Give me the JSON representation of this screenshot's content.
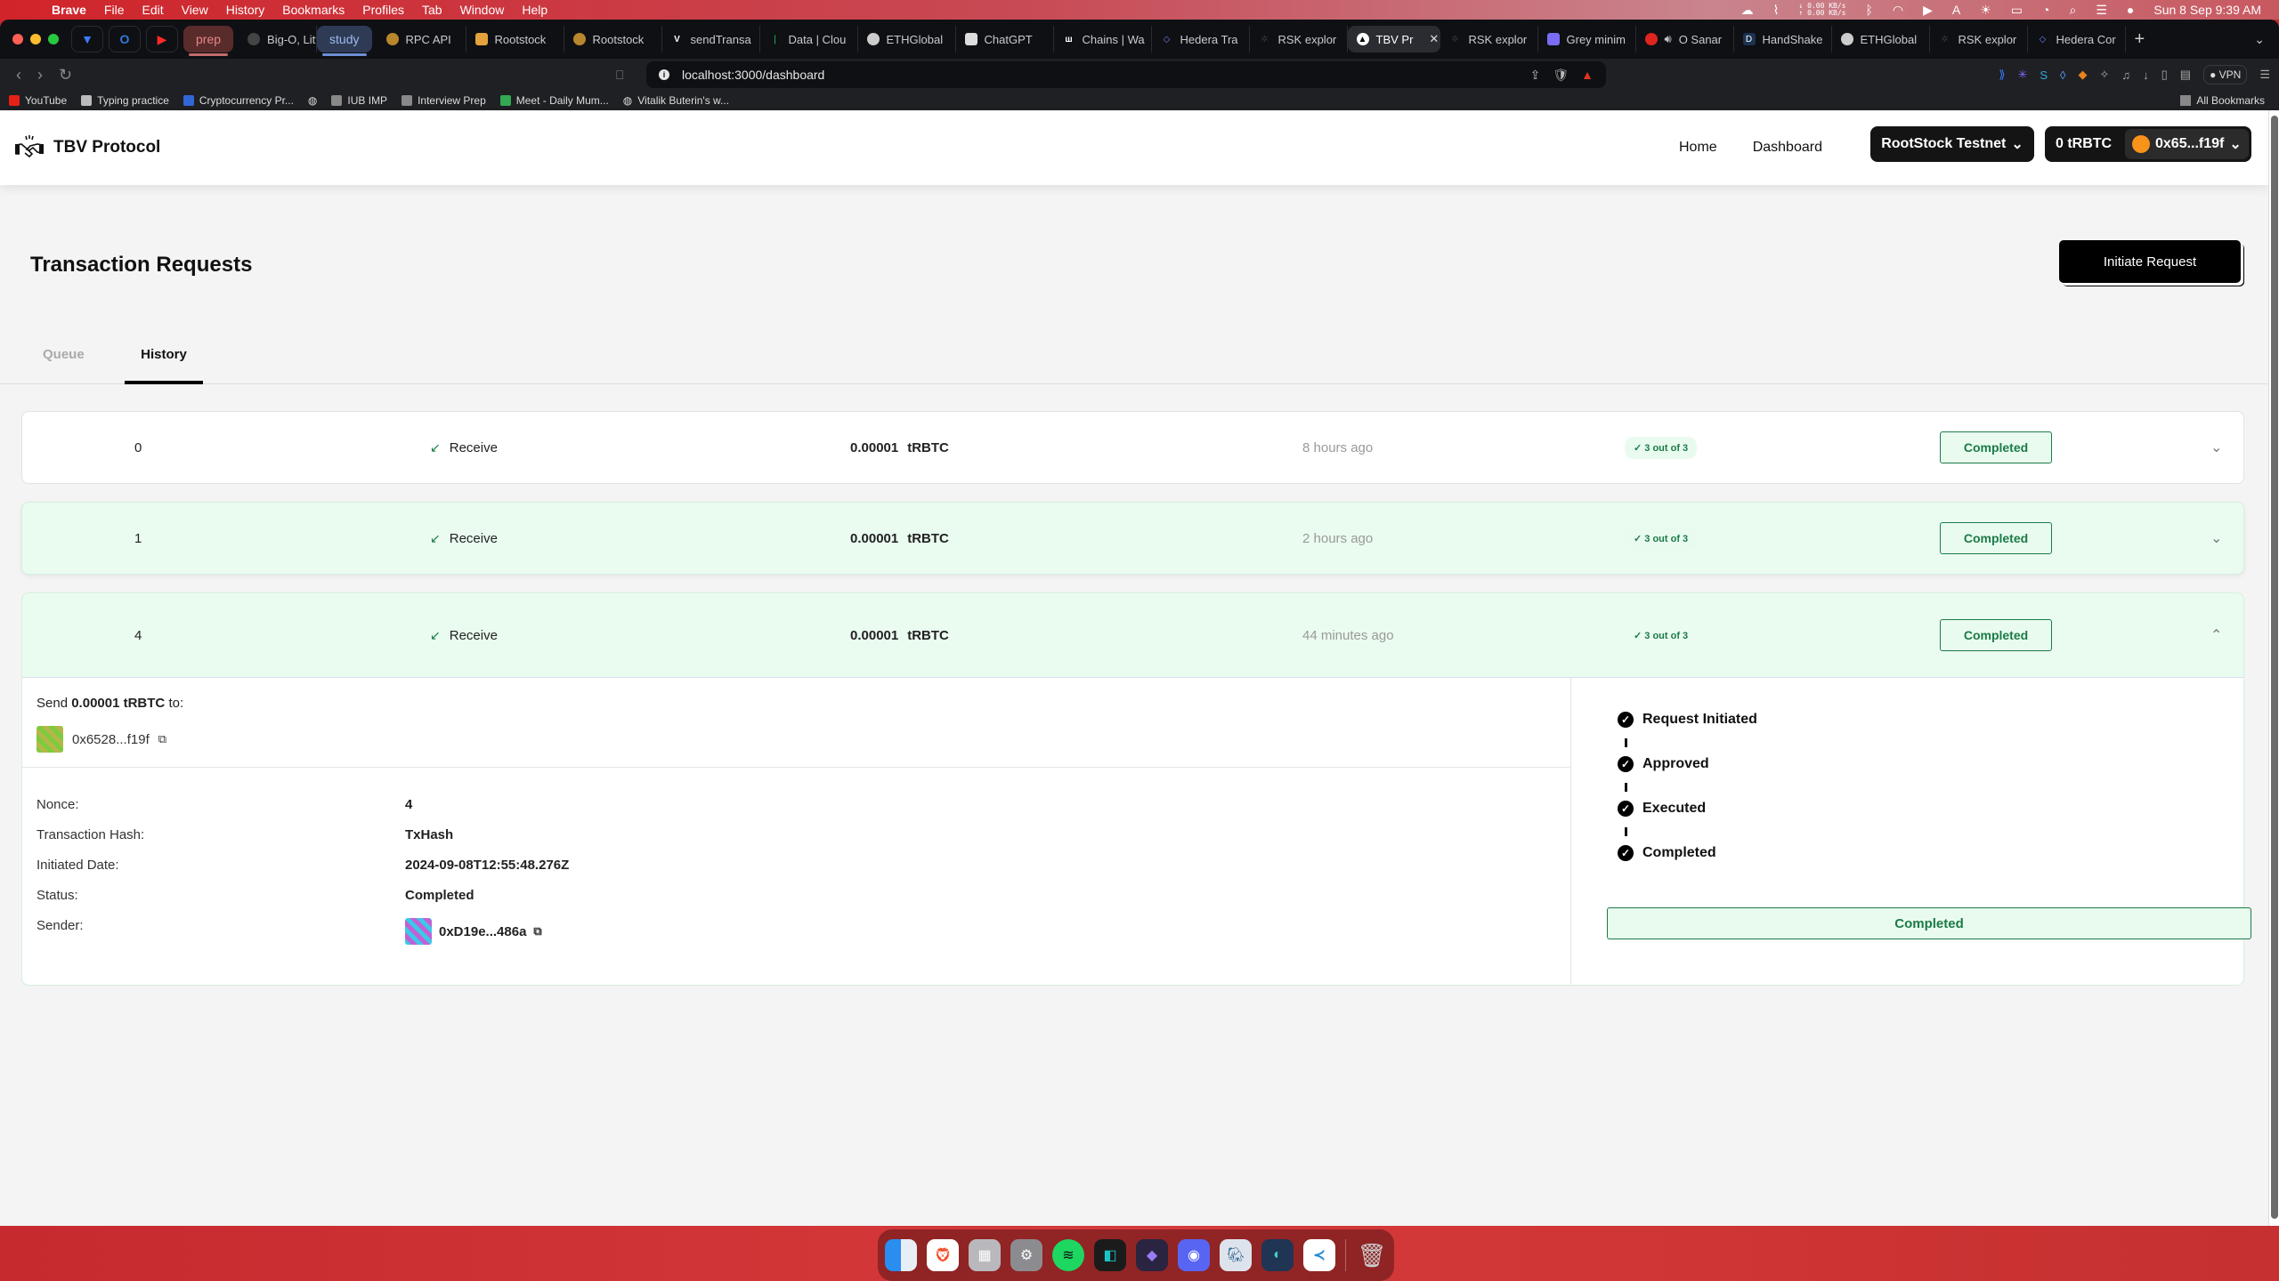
{
  "menubar": {
    "app": "Brave",
    "items": [
      "File",
      "Edit",
      "View",
      "History",
      "Bookmarks",
      "Profiles",
      "Tab",
      "Window",
      "Help"
    ],
    "net_down": "↓ 0.00 KB/s",
    "net_up": "↑ 0.00 KB/s",
    "clock": "Sun 8 Sep  9:39 AM"
  },
  "browser": {
    "tab_groups": [
      "prep",
      "study"
    ],
    "tabs": [
      {
        "label": "Big-O, Littl",
        "group": "prep"
      },
      {
        "label": "RPC API",
        "group": "study"
      },
      {
        "label": "Rootstock"
      },
      {
        "label": "Rootstock"
      },
      {
        "label": "sendTransa"
      },
      {
        "label": "Data | Clou"
      },
      {
        "label": "ETHGlobal"
      },
      {
        "label": "ChatGPT"
      },
      {
        "label": "Chains | Wa"
      },
      {
        "label": "Hedera Tra"
      },
      {
        "label": "RSK explor"
      },
      {
        "label": "TBV Pr",
        "active": true
      },
      {
        "label": "RSK explor"
      },
      {
        "label": "Grey minim"
      },
      {
        "label": "O Sanar"
      },
      {
        "label": "HandShake"
      },
      {
        "label": "ETHGlobal"
      },
      {
        "label": "RSK explor"
      },
      {
        "label": "Hedera Cor"
      }
    ],
    "url": "localhost:3000/dashboard",
    "vpn_label": "VPN",
    "bookmarks": [
      "YouTube",
      "Typing practice",
      "Cryptocurrency Pr...",
      "",
      "IUB IMP",
      "Interview Prep",
      "Meet - Daily Mum...",
      "Vitalik Buterin's w..."
    ],
    "all_bookmarks": "All Bookmarks"
  },
  "app": {
    "brand": "TBV Protocol",
    "nav": [
      "Home",
      "Dashboard"
    ],
    "network": "RootStock Testnet",
    "balance": "0 tRBTC",
    "account": "0x65...f19f",
    "page_title": "Transaction Requests",
    "initiate_label": "Initiate Request",
    "tabs": {
      "queue": "Queue",
      "history": "History",
      "active": "History"
    },
    "colors": {
      "accent_green": "#1b7b47",
      "row_highlight": "#eafcf0",
      "primary": "#000000"
    }
  },
  "transactions": [
    {
      "nonce": "0",
      "type": "Receive",
      "amount": "0.00001",
      "token": "tRBTC",
      "time": "8 hours ago",
      "confirmations": "3 out of 3",
      "status": "Completed",
      "expanded": false
    },
    {
      "nonce": "1",
      "type": "Receive",
      "amount": "0.00001",
      "token": "tRBTC",
      "time": "2 hours ago",
      "confirmations": "3 out of 3",
      "status": "Completed",
      "expanded": false
    },
    {
      "nonce": "4",
      "type": "Receive",
      "amount": "0.00001",
      "token": "tRBTC",
      "time": "44 minutes ago",
      "confirmations": "3 out of 3",
      "status": "Completed",
      "expanded": true
    }
  ],
  "detail": {
    "send_prefix": "Send",
    "send_amount": "0.00001 tRBTC",
    "send_suffix": "to:",
    "recipient": "0x6528...f19f",
    "fields": [
      {
        "label": "Nonce:",
        "value": "4"
      },
      {
        "label": "Transaction Hash:",
        "value": "TxHash"
      },
      {
        "label": "Initiated Date:",
        "value": "2024-09-08T12:55:48.276Z"
      },
      {
        "label": "Status:",
        "value": "Completed"
      },
      {
        "label": "Sender:",
        "value": "0xD19e...486a"
      }
    ],
    "steps": [
      "Request Initiated",
      "Approved",
      "Executed",
      "Completed"
    ],
    "final_status": "Completed"
  }
}
